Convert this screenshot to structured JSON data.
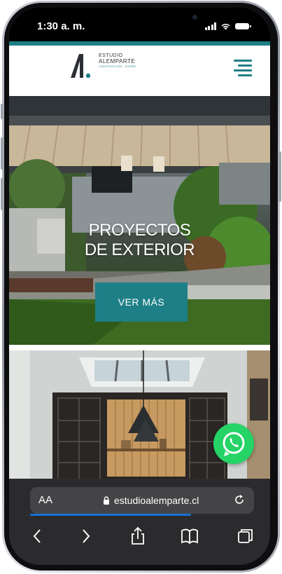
{
  "status_bar": {
    "time": "1:30 a. m."
  },
  "site": {
    "logo_letter": "A.",
    "logo_line1": "ESTUDIO",
    "logo_line2": "ALEMPARTE",
    "logo_line3": "CONSTRUCCIÓN · DISEÑO"
  },
  "hero": {
    "title_line1": "PROYECTOS",
    "title_line2": "DE EXTERIOR",
    "cta_label": "VER MÁS"
  },
  "browser": {
    "aa_label": "AA",
    "url": "estudioalemparte.cl",
    "load_progress": 0.72
  },
  "icons": {
    "menu": "hamburger-icon",
    "whatsapp": "whatsapp-icon",
    "lock": "lock-icon",
    "reload": "reload-icon",
    "back": "chevron-left-icon",
    "forward": "chevron-right-icon",
    "share": "share-icon",
    "bookmarks": "book-icon",
    "tabs": "tabs-icon"
  },
  "colors": {
    "brand_teal": "#1e7f87",
    "whatsapp_green": "#25d366",
    "browser_chrome": "#2b2b2d"
  }
}
